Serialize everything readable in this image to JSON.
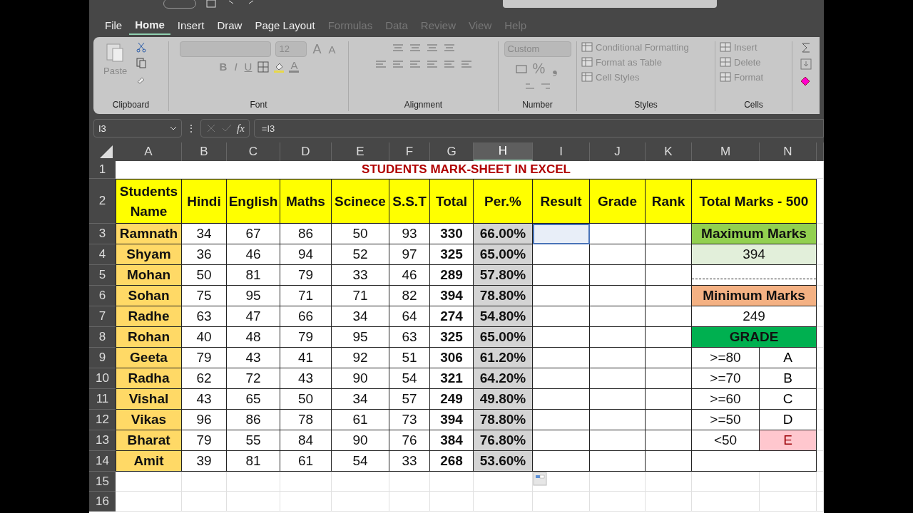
{
  "ribbon_tabs": [
    {
      "label": "File",
      "selected": false
    },
    {
      "label": "Home",
      "selected": true
    },
    {
      "label": "Insert",
      "selected": false
    },
    {
      "label": "Draw",
      "selected": false
    },
    {
      "label": "Page Layout",
      "selected": false
    },
    {
      "label": "Formulas",
      "selected": false
    },
    {
      "label": "Data",
      "selected": false
    },
    {
      "label": "Review",
      "selected": false
    },
    {
      "label": "View",
      "selected": false
    },
    {
      "label": "Help",
      "selected": false
    }
  ],
  "ribbon": {
    "paste_label": "Paste",
    "font_size": "12",
    "grow_shrink": [
      "A",
      "A"
    ],
    "format_buttons": [
      "B",
      "I",
      "U"
    ],
    "font_color": "A",
    "number_format": "Custom",
    "number_buttons": [
      "%",
      "❟"
    ],
    "styles_commands": [
      "Conditional Formatting",
      "Format as Table",
      "Cell Styles"
    ],
    "cells_commands": [
      "Insert",
      "Delete",
      "Format"
    ],
    "groups": [
      "Clipboard",
      "Font",
      "Alignment",
      "Number",
      "Styles",
      "Cells"
    ]
  },
  "formula_bar": {
    "name_box": "I3",
    "more": "⋮",
    "fx": "fx",
    "formula": "=I3"
  },
  "columns": [
    {
      "label": "A",
      "selected": false
    },
    {
      "label": "B",
      "selected": false
    },
    {
      "label": "C",
      "selected": false
    },
    {
      "label": "D",
      "selected": false
    },
    {
      "label": "E",
      "selected": false
    },
    {
      "label": "F",
      "selected": false
    },
    {
      "label": "G",
      "selected": false
    },
    {
      "label": "H",
      "selected": true
    },
    {
      "label": "I",
      "selected": false
    },
    {
      "label": "J",
      "selected": false
    },
    {
      "label": "K",
      "selected": false
    },
    {
      "label": "M",
      "selected": false
    },
    {
      "label": "N",
      "selected": false
    }
  ],
  "row_numbers": [
    "1",
    "2",
    "3",
    "4",
    "5",
    "6",
    "7",
    "8",
    "9",
    "10",
    "11",
    "12",
    "13",
    "14",
    "15",
    "16"
  ],
  "title": "STUDENTS MARK-SHEET IN EXCEL",
  "headers": [
    "Students Name",
    "Hindi",
    "English",
    "Maths",
    "Scinece",
    "S.S.T",
    "Total",
    "Per.%",
    "Result",
    "Grade",
    "Rank"
  ],
  "summary_header": "Total Marks - 500",
  "students": [
    {
      "name": "Ramnath",
      "marks": [
        "34",
        "67",
        "86",
        "50",
        "93"
      ],
      "total": "330",
      "percent": "66.00%",
      "result_selected": true
    },
    {
      "name": "Shyam",
      "marks": [
        "36",
        "46",
        "94",
        "52",
        "97"
      ],
      "total": "325",
      "percent": "65.00%",
      "result_selected": false
    },
    {
      "name": "Mohan",
      "marks": [
        "50",
        "81",
        "79",
        "33",
        "46"
      ],
      "total": "289",
      "percent": "57.80%",
      "result_selected": false
    },
    {
      "name": "Sohan",
      "marks": [
        "75",
        "95",
        "71",
        "71",
        "82"
      ],
      "total": "394",
      "percent": "78.80%",
      "result_selected": false
    },
    {
      "name": "Radhe",
      "marks": [
        "63",
        "47",
        "66",
        "34",
        "64"
      ],
      "total": "274",
      "percent": "54.80%",
      "result_selected": false
    },
    {
      "name": "Rohan",
      "marks": [
        "40",
        "48",
        "79",
        "95",
        "63"
      ],
      "total": "325",
      "percent": "65.00%",
      "result_selected": false
    },
    {
      "name": "Geeta",
      "marks": [
        "79",
        "43",
        "41",
        "92",
        "51"
      ],
      "total": "306",
      "percent": "61.20%",
      "result_selected": false
    },
    {
      "name": "Radha",
      "marks": [
        "62",
        "72",
        "43",
        "90",
        "54"
      ],
      "total": "321",
      "percent": "64.20%",
      "result_selected": false
    },
    {
      "name": "Vishal",
      "marks": [
        "43",
        "65",
        "50",
        "34",
        "57"
      ],
      "total": "249",
      "percent": "49.80%",
      "result_selected": false
    },
    {
      "name": "Vikas",
      "marks": [
        "96",
        "86",
        "78",
        "61",
        "73"
      ],
      "total": "394",
      "percent": "78.80%",
      "result_selected": false
    },
    {
      "name": "Bharat",
      "marks": [
        "79",
        "55",
        "84",
        "90",
        "76"
      ],
      "total": "384",
      "percent": "76.80%",
      "result_selected": false
    },
    {
      "name": "Amit",
      "marks": [
        "39",
        "81",
        "61",
        "54",
        "33"
      ],
      "total": "268",
      "percent": "53.60%",
      "result_selected": false
    }
  ],
  "summary": [
    {
      "kind": "heading",
      "text": "Maximum Marks",
      "color": "#92d050"
    },
    {
      "kind": "value",
      "text": "394",
      "color": "#e2efda"
    },
    {
      "kind": "divider"
    },
    {
      "kind": "heading",
      "text": "Minimum Marks",
      "color": "#f4b183"
    },
    {
      "kind": "value",
      "text": "249",
      "color": "#ffffff"
    },
    {
      "kind": "heading",
      "text": "GRADE",
      "color": "#00b050"
    },
    {
      "kind": "grade",
      "rule": ">=80",
      "grade": "A",
      "color": "#ffffff"
    },
    {
      "kind": "grade",
      "rule": ">=70",
      "grade": "B",
      "color": "#ffffff"
    },
    {
      "kind": "grade",
      "rule": ">=60",
      "grade": "C",
      "color": "#ffffff"
    },
    {
      "kind": "grade",
      "rule": ">=50",
      "grade": "D",
      "color": "#ffffff"
    },
    {
      "kind": "grade",
      "rule": "<50",
      "grade": "E",
      "color": "#ffc7ce"
    },
    {
      "kind": "blank"
    }
  ]
}
